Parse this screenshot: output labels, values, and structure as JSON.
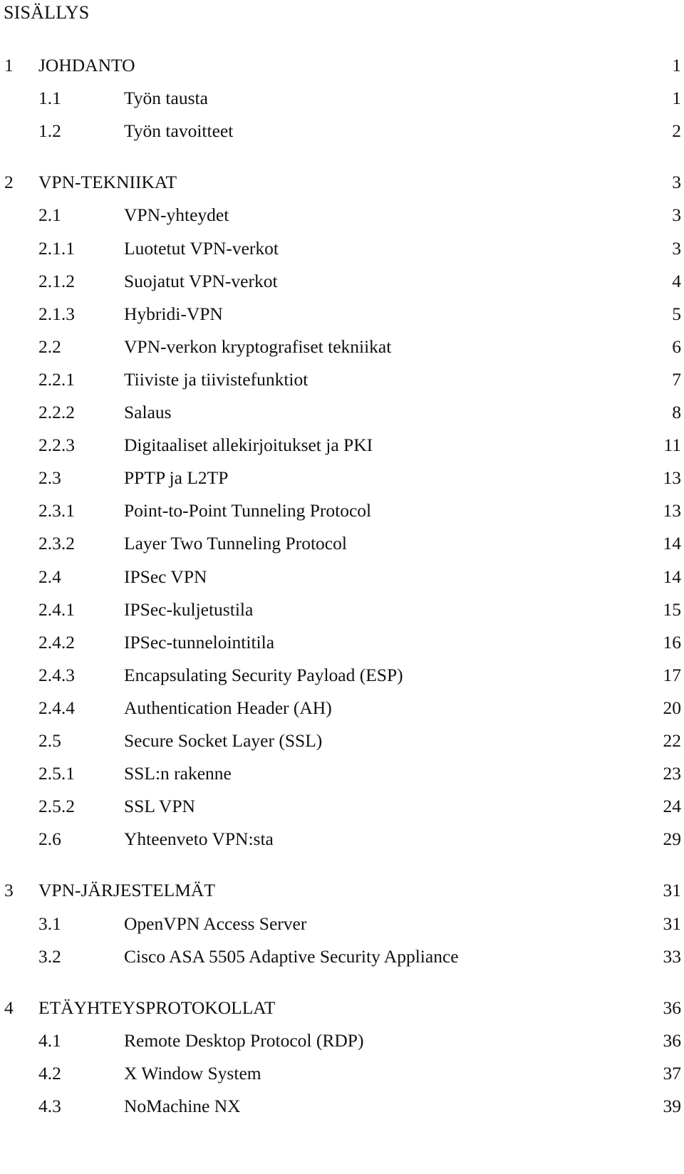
{
  "toc": {
    "heading": "SISÄLLYS",
    "entries": [
      {
        "level": 1,
        "number": "1",
        "title": "JOHDANTO",
        "page": "1"
      },
      {
        "level": 2,
        "number": "1.1",
        "title": "Työn tausta",
        "page": "1"
      },
      {
        "level": 2,
        "number": "1.2",
        "title": "Työn tavoitteet",
        "page": "2"
      },
      {
        "level": 1,
        "number": "2",
        "title": "VPN-TEKNIIKAT",
        "page": "3"
      },
      {
        "level": 2,
        "number": "2.1",
        "title": "VPN-yhteydet",
        "page": "3"
      },
      {
        "level": 2,
        "number": "2.1.1",
        "title": "Luotetut VPN-verkot",
        "page": "3"
      },
      {
        "level": 2,
        "number": "2.1.2",
        "title": "Suojatut VPN-verkot",
        "page": "4"
      },
      {
        "level": 2,
        "number": "2.1.3",
        "title": "Hybridi-VPN",
        "page": "5"
      },
      {
        "level": 2,
        "number": "2.2",
        "title": "VPN-verkon kryptografiset tekniikat",
        "page": "6"
      },
      {
        "level": 2,
        "number": "2.2.1",
        "title": "Tiiviste ja tiivistefunktiot",
        "page": "7"
      },
      {
        "level": 2,
        "number": "2.2.2",
        "title": "Salaus",
        "page": "8"
      },
      {
        "level": 2,
        "number": "2.2.3",
        "title": "Digitaaliset allekirjoitukset ja PKI",
        "page": "11"
      },
      {
        "level": 2,
        "number": "2.3",
        "title": "PPTP ja L2TP",
        "page": "13"
      },
      {
        "level": 2,
        "number": "2.3.1",
        "title": "Point-to-Point Tunneling Protocol",
        "page": "13"
      },
      {
        "level": 2,
        "number": "2.3.2",
        "title": "Layer Two Tunneling Protocol",
        "page": "14"
      },
      {
        "level": 2,
        "number": "2.4",
        "title": "IPSec VPN",
        "page": "14"
      },
      {
        "level": 2,
        "number": "2.4.1",
        "title": "IPSec-kuljetustila",
        "page": "15"
      },
      {
        "level": 2,
        "number": "2.4.2",
        "title": "IPSec-tunnelointitila",
        "page": "16"
      },
      {
        "level": 2,
        "number": "2.4.3",
        "title": "Encapsulating Security Payload (ESP)",
        "page": "17"
      },
      {
        "level": 2,
        "number": "2.4.4",
        "title": "Authentication Header (AH)",
        "page": "20"
      },
      {
        "level": 2,
        "number": "2.5",
        "title": "Secure Socket Layer (SSL)",
        "page": "22"
      },
      {
        "level": 2,
        "number": "2.5.1",
        "title": "SSL:n rakenne",
        "page": "23"
      },
      {
        "level": 2,
        "number": "2.5.2",
        "title": "SSL VPN",
        "page": "24"
      },
      {
        "level": 2,
        "number": "2.6",
        "title": "Yhteenveto VPN:sta",
        "page": "29"
      },
      {
        "level": 1,
        "number": "3",
        "title": "VPN-JÄRJESTELMÄT",
        "page": "31"
      },
      {
        "level": 2,
        "number": "3.1",
        "title": "OpenVPN Access Server",
        "page": "31"
      },
      {
        "level": 2,
        "number": "3.2",
        "title": "Cisco ASA 5505 Adaptive Security Appliance",
        "page": "33"
      },
      {
        "level": 1,
        "number": "4",
        "title": "ETÄYHTEYSPROTOKOLLAT",
        "page": "36"
      },
      {
        "level": 2,
        "number": "4.1",
        "title": "Remote Desktop Protocol (RDP)",
        "page": "36"
      },
      {
        "level": 2,
        "number": "4.2",
        "title": "X Window System",
        "page": "37"
      },
      {
        "level": 2,
        "number": "4.3",
        "title": "NoMachine NX",
        "page": "39"
      }
    ]
  }
}
